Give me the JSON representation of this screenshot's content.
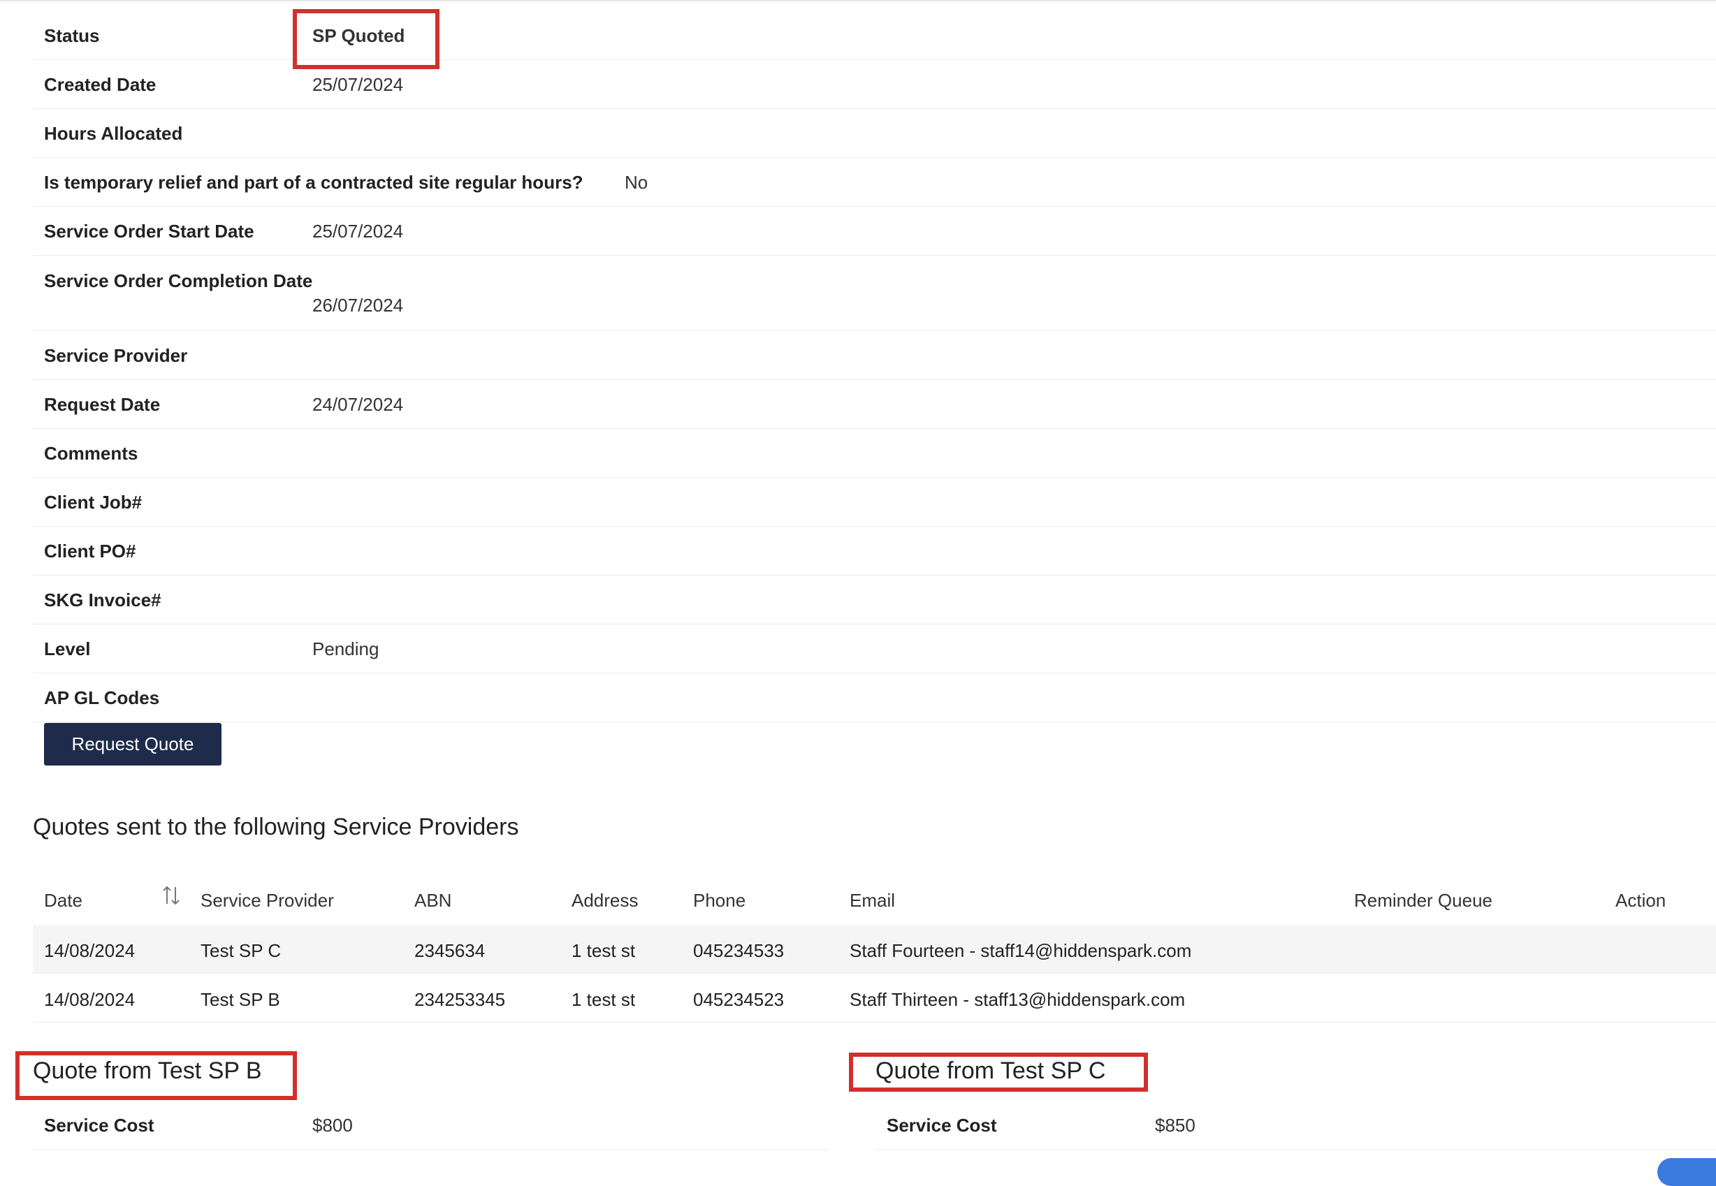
{
  "details": {
    "status": {
      "label": "Status",
      "value": "SP Quoted"
    },
    "created_date": {
      "label": "Created Date",
      "value": "25/07/2024"
    },
    "hours_allocated": {
      "label": "Hours Allocated",
      "value": ""
    },
    "temporary_relief": {
      "label": "Is temporary relief and part of a contracted site regular hours?",
      "value": "No"
    },
    "start_date": {
      "label": "Service Order Start Date",
      "value": "25/07/2024"
    },
    "completion_date": {
      "label": "Service Order Completion Date",
      "value": "26/07/2024"
    },
    "service_provider": {
      "label": "Service Provider",
      "value": ""
    },
    "request_date": {
      "label": "Request Date",
      "value": "24/07/2024"
    },
    "comments": {
      "label": "Comments",
      "value": ""
    },
    "client_job": {
      "label": "Client Job#",
      "value": ""
    },
    "client_po": {
      "label": "Client PO#",
      "value": ""
    },
    "skg_invoice": {
      "label": "SKG Invoice#",
      "value": ""
    },
    "level": {
      "label": "Level",
      "value": "Pending"
    },
    "ap_gl_codes": {
      "label": "AP GL Codes",
      "value": ""
    }
  },
  "request_quote_button": "Request Quote",
  "quotes_section": {
    "heading": "Quotes sent to the following Service Providers",
    "sort_icon": "sort-arrows-icon",
    "columns": {
      "date": "Date",
      "service_provider": "Service Provider",
      "abn": "ABN",
      "address": "Address",
      "phone": "Phone",
      "email": "Email",
      "reminder_queue": "Reminder Queue",
      "action": "Action"
    },
    "rows": [
      {
        "date": "14/08/2024",
        "service_provider": "Test SP C",
        "abn": "2345634",
        "address": "1 test st",
        "phone": "045234533",
        "email": "Staff Fourteen - staff14@hiddenspark.com",
        "reminder_queue": "",
        "action": ""
      },
      {
        "date": "14/08/2024",
        "service_provider": "Test SP B",
        "abn": "234253345",
        "address": "1 test st",
        "phone": "045234523",
        "email": "Staff Thirteen - staff13@hiddenspark.com",
        "reminder_queue": "",
        "action": ""
      }
    ]
  },
  "quote_b": {
    "title": "Quote from Test SP B",
    "cost_label": "Service Cost",
    "cost_value": "$800"
  },
  "quote_c": {
    "title": "Quote from Test SP C",
    "cost_label": "Service Cost",
    "cost_value": "$850"
  },
  "colors": {
    "highlight_box": "#d2302c",
    "status_text": "#1818dd",
    "button_bg": "#1e2b4a"
  }
}
